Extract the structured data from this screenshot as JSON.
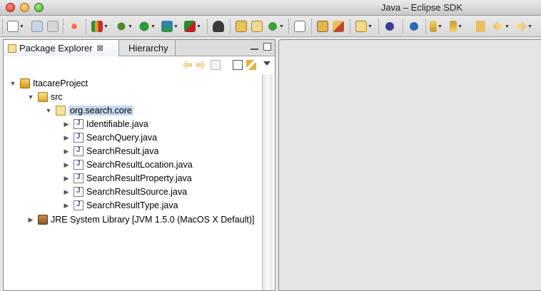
{
  "window": {
    "title": "Java – Eclipse SDK"
  },
  "toolbar": {
    "buttons": [
      {
        "icon": "new-wizard-icon",
        "dropdown": true
      },
      {
        "icon": "save-icon",
        "dropdown": false
      },
      {
        "icon": "print-icon",
        "dropdown": false
      },
      {
        "icon": "toggle-ant-icon",
        "dropdown": false
      },
      {
        "icon": "run-external-icon",
        "dropdown": true
      },
      {
        "icon": "debug-icon",
        "dropdown": true
      },
      {
        "icon": "run-icon",
        "dropdown": true
      },
      {
        "icon": "coverage-icon",
        "dropdown": true
      },
      {
        "icon": "external-tools-icon",
        "dropdown": true
      },
      {
        "icon": "search-perspective-icon",
        "dropdown": false
      },
      {
        "icon": "new-java-project-icon",
        "dropdown": false
      },
      {
        "icon": "new-package-icon",
        "dropdown": false
      },
      {
        "icon": "new-class-icon",
        "dropdown": true
      },
      {
        "icon": "open-task-icon",
        "dropdown": false
      },
      {
        "icon": "open-type-icon",
        "dropdown": false
      },
      {
        "icon": "open-resource-icon",
        "dropdown": false
      },
      {
        "icon": "search-icon",
        "dropdown": true
      },
      {
        "icon": "globe-icon",
        "dropdown": false
      },
      {
        "icon": "web-icon",
        "dropdown": false
      },
      {
        "icon": "next-annotation-icon",
        "dropdown": true
      },
      {
        "icon": "previous-annotation-icon",
        "dropdown": true
      },
      {
        "icon": "last-edit-icon",
        "dropdown": false
      },
      {
        "icon": "back-icon",
        "dropdown": true
      },
      {
        "icon": "forward-icon",
        "dropdown": true
      }
    ]
  },
  "views": {
    "tabs": [
      {
        "label": "Package Explorer",
        "active": true,
        "close": "⊠"
      },
      {
        "label": "Hierarchy",
        "active": false
      }
    ]
  },
  "tree": {
    "project": "ItacareProject",
    "source_folder": "src",
    "package": "org.search.core",
    "files": [
      "Identifiable.java",
      "SearchQuery.java",
      "SearchResult.java",
      "SearchResultLocation.java",
      "SearchResultProperty.java",
      "SearchResultSource.java",
      "SearchResultType.java"
    ],
    "library": "JRE System Library [JVM 1.5.0 (MacOS X Default)]"
  },
  "colors": {
    "selection": "#c5d9f0",
    "accent": "#3a5aa8"
  }
}
